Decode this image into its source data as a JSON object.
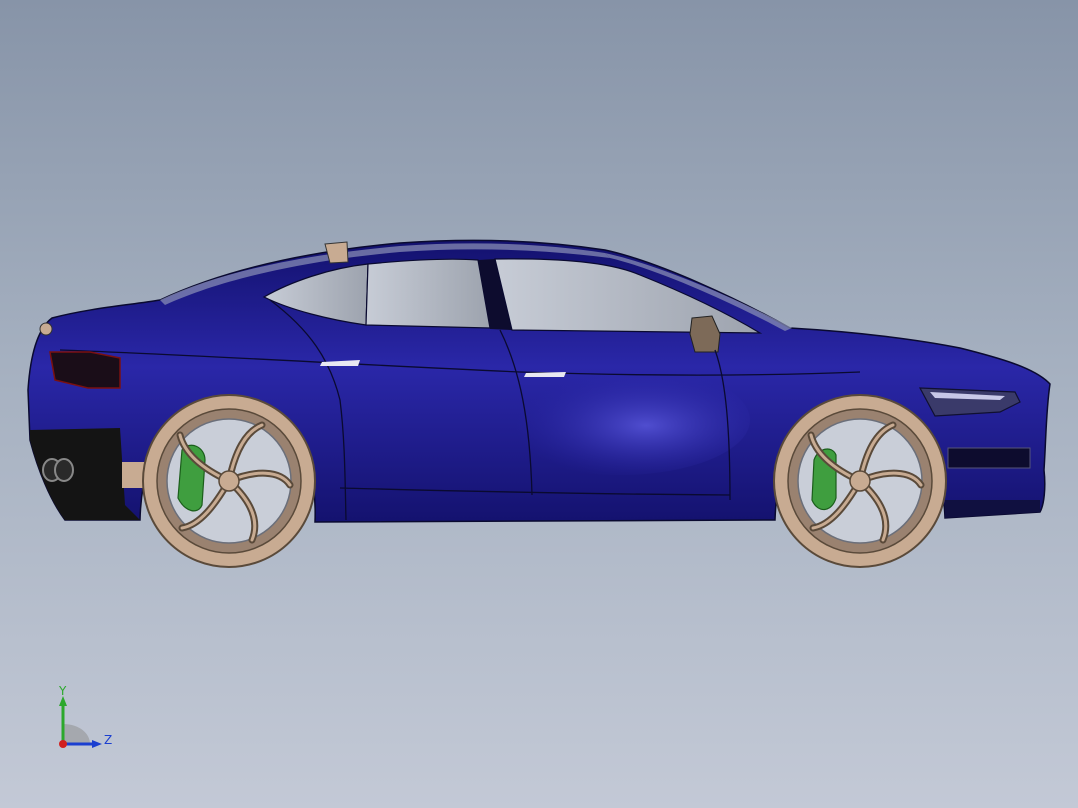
{
  "viewport": {
    "background_top": "#8794a8",
    "background_bottom": "#c3c9d6"
  },
  "model": {
    "body_color": "#1c1a86",
    "wheel_color": "#c8ab92",
    "caliper_color": "#3f9e3f",
    "glass_color": "#a9aeb8"
  },
  "triad": {
    "y_label": "Y",
    "z_label": "Z",
    "y_color": "#2ca82c",
    "z_color": "#1b3fd0",
    "x_color": "#d12020"
  }
}
